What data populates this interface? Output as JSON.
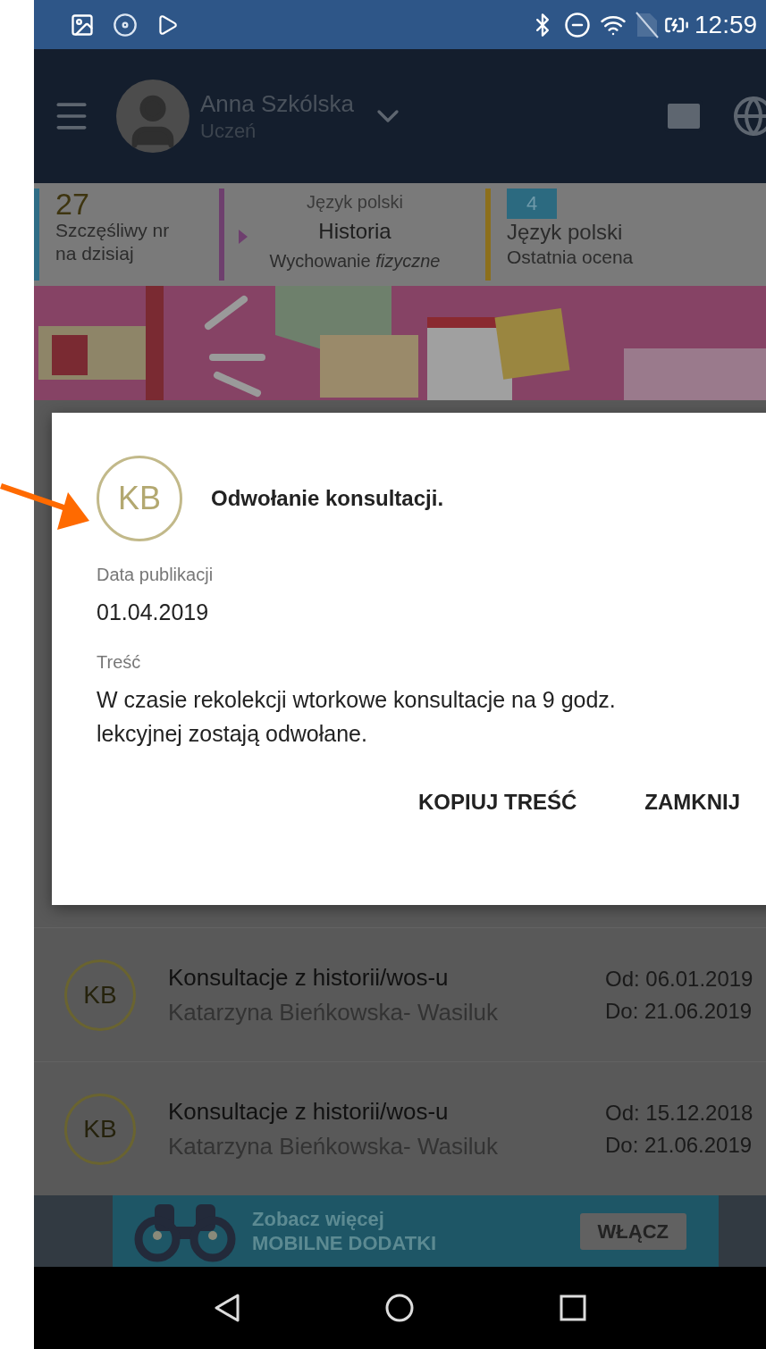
{
  "status_bar": {
    "time": "12:59"
  },
  "header": {
    "name": "Anna Szkólska",
    "role": "Uczeń"
  },
  "tiles": {
    "lucky": {
      "number": "27",
      "lines": [
        "Szczęśliwy nr",
        "na dzisiaj"
      ]
    },
    "schedule": {
      "previous": "Język polski",
      "current": "Historia",
      "next_plain": "Wychowanie ",
      "next_italic": "fizyczne"
    },
    "grade": {
      "value": "4",
      "subject": "Język polski",
      "label": "Ostatnia ocena"
    }
  },
  "list": [
    {
      "initials": "KB",
      "title": "Konsultacje z historii/wos-u",
      "author": "Katarzyna Bieńkowska- Wasiluk",
      "from": "Od: 06.01.2019",
      "to": "Do: 21.06.2019"
    },
    {
      "initials": "KB",
      "title": "Konsultacje z historii/wos-u",
      "author": "Katarzyna Bieńkowska- Wasiluk",
      "from": "Od: 15.12.2018",
      "to": "Do: 21.06.2019"
    }
  ],
  "dialog": {
    "initials": "KB",
    "title": "Odwołanie konsultacji.",
    "fields": [
      {
        "label": "Data publikacji",
        "value": "01.04.2019"
      },
      {
        "label": "Treść",
        "value": "W czasie rekolekcji wtorkowe konsultacje na 9 godz. lekcyjnej zostają odwołane."
      }
    ],
    "buttons": [
      "KOPIUJ TREŚĆ",
      "ZAMKNIJ"
    ]
  },
  "ad": {
    "line1": "Zobacz więcej",
    "line2": "MOBILNE DODATKI",
    "button": "WŁĄCZ"
  }
}
